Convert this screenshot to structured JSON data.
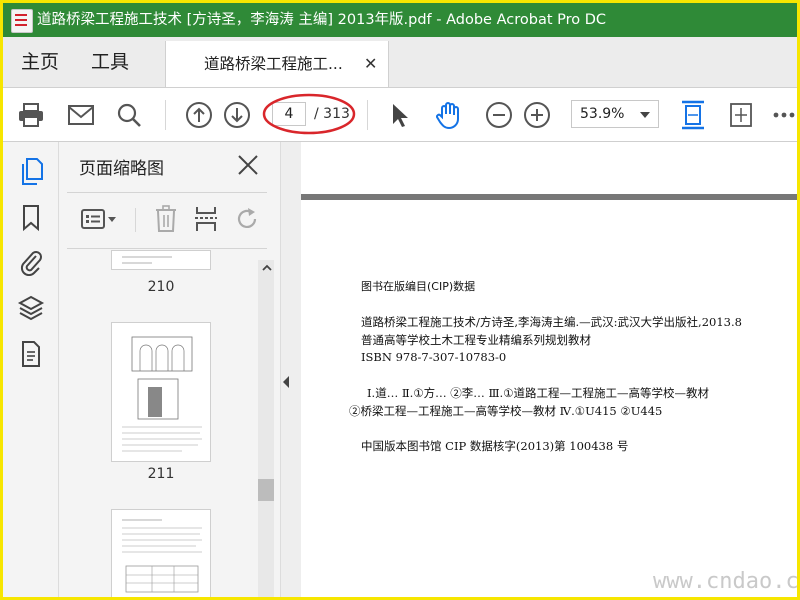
{
  "window": {
    "title": "道路桥梁工程施工技术 [方诗圣，李海涛 主编] 2013年版.pdf - Adobe Acrobat Pro DC"
  },
  "menubar": {
    "home": "主页",
    "tools": "工具",
    "doc_tab": "道路桥梁工程施工..."
  },
  "toolbar": {
    "page_current": "4",
    "page_total": "/ 313",
    "zoom": "53.9%"
  },
  "colors": {
    "titlebar": "#2f8a37",
    "accent_blue": "#1473e6",
    "highlight_circle": "#d9262b",
    "frame": "#f7e600"
  },
  "icons": [
    "print-icon",
    "mail-icon",
    "search-icon",
    "prev-page-icon",
    "next-page-icon",
    "select-cursor-icon",
    "hand-icon",
    "zoom-out-icon",
    "zoom-in-icon",
    "fit-width-icon",
    "fit-page-icon",
    "more-icon"
  ],
  "panel": {
    "title": "页面缩略图",
    "thumbs": [
      {
        "label": "210"
      },
      {
        "label": "211"
      }
    ]
  },
  "document": {
    "cip_title": "图书在版编目(CIP)数据",
    "lines": [
      "道路桥梁工程施工技术/方诗圣,李海涛主编.—武汉:武汉大学出版社,2013.8",
      "普通高等学校土木工程专业精编系列规划教材",
      "ISBN 978-7-307-10783-0",
      "Ⅰ.道…  Ⅱ.①方…  ②李…  Ⅲ.①道路工程—工程施工—高等学校—教材",
      "②桥梁工程—工程施工—高等学校—教材  Ⅳ.①U415  ②U445",
      "中国版本图书馆 CIP 数据核字(2013)第 100438 号"
    ]
  },
  "watermark": "www.cndao.com"
}
